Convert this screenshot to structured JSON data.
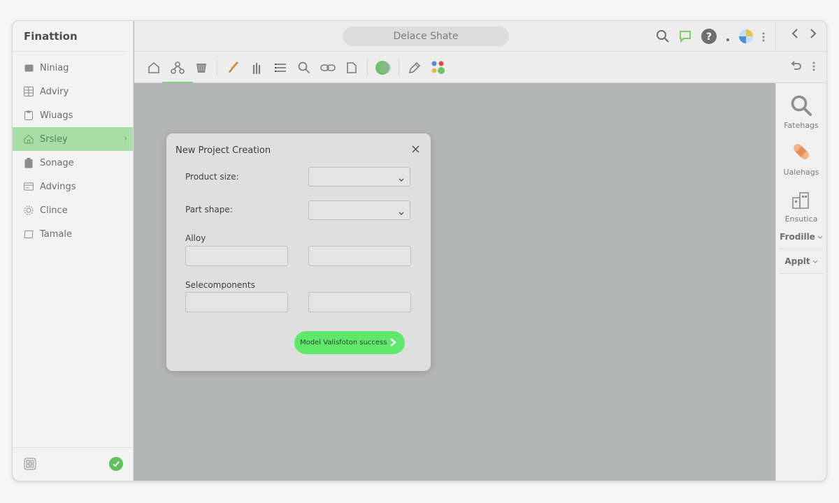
{
  "app": {
    "brand": "Finattion"
  },
  "sidebar": {
    "items": [
      {
        "label": "Niniag",
        "icon": "folder-icon"
      },
      {
        "label": "Adviry",
        "icon": "grid-table-icon"
      },
      {
        "label": "Wiuags",
        "icon": "clipboard-icon"
      },
      {
        "label": "Srsley",
        "icon": "home-icon",
        "active": true
      },
      {
        "label": "Sonage",
        "icon": "battery-icon"
      },
      {
        "label": "Advings",
        "icon": "card-icon"
      },
      {
        "label": "Clince",
        "icon": "gear-outline-icon"
      },
      {
        "label": "Tamale",
        "icon": "tablet-icon"
      }
    ]
  },
  "topbar": {
    "document_title": "Delace Shate"
  },
  "right_panel": {
    "items": [
      {
        "label": "Fatehags",
        "icon": "magnifier-icon"
      },
      {
        "label": "Ualehags",
        "icon": "bandage-icon"
      },
      {
        "label": "Ensutica",
        "icon": "building-blocks-icon"
      }
    ],
    "dropdowns": [
      "Frodille",
      "Applt"
    ]
  },
  "dialog": {
    "title": "New Project Creation",
    "product_size_label": "Product size:",
    "product_size_value": "",
    "part_shape_label": "Part shape:",
    "part_shape_value": "",
    "alloy_label": "Alloy",
    "selecomponents_label": "Selecomponents",
    "primary_button_label": "Model Valisfoton success"
  },
  "colors": {
    "accent_green": "#a6dea5",
    "success_button": "#5fe86a",
    "success_badge": "#5fc25e",
    "canvas_gray": "#b4b5b5"
  }
}
